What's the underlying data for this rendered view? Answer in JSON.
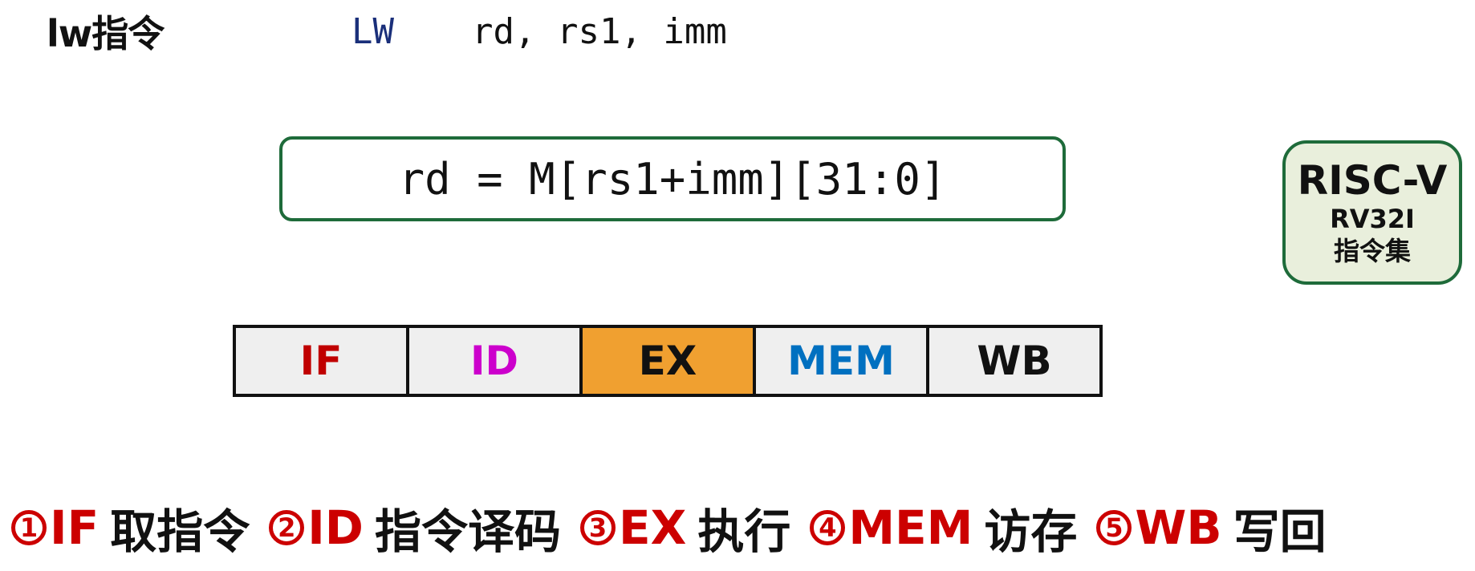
{
  "header": {
    "title": "lw指令",
    "syntax_op": "LW",
    "syntax_args": "rd, rs1, imm"
  },
  "formula": "rd = M[rs1+imm][31:0]",
  "isa_badge": {
    "name": "RISC-V",
    "variant": "RV32I",
    "label": "指令集"
  },
  "pipeline": {
    "stages": [
      {
        "label": "IF",
        "text_color": "#c00000",
        "fill": "#efefef"
      },
      {
        "label": "ID",
        "text_color": "#cc00cc",
        "fill": "#efefef"
      },
      {
        "label": "EX",
        "text_color": "#111111",
        "fill": "#f0a030"
      },
      {
        "label": "MEM",
        "text_color": "#0070c0",
        "fill": "#efefef"
      },
      {
        "label": "WB",
        "text_color": "#111111",
        "fill": "#efefef"
      }
    ],
    "active_stage": "EX"
  },
  "legend": [
    {
      "num": "1",
      "abbr": "IF",
      "desc": "取指令"
    },
    {
      "num": "2",
      "abbr": "ID",
      "desc": "指令译码"
    },
    {
      "num": "3",
      "abbr": "EX",
      "desc": "执行"
    },
    {
      "num": "4",
      "abbr": "MEM",
      "desc": "访存"
    },
    {
      "num": "5",
      "abbr": "WB",
      "desc": "写回"
    }
  ]
}
